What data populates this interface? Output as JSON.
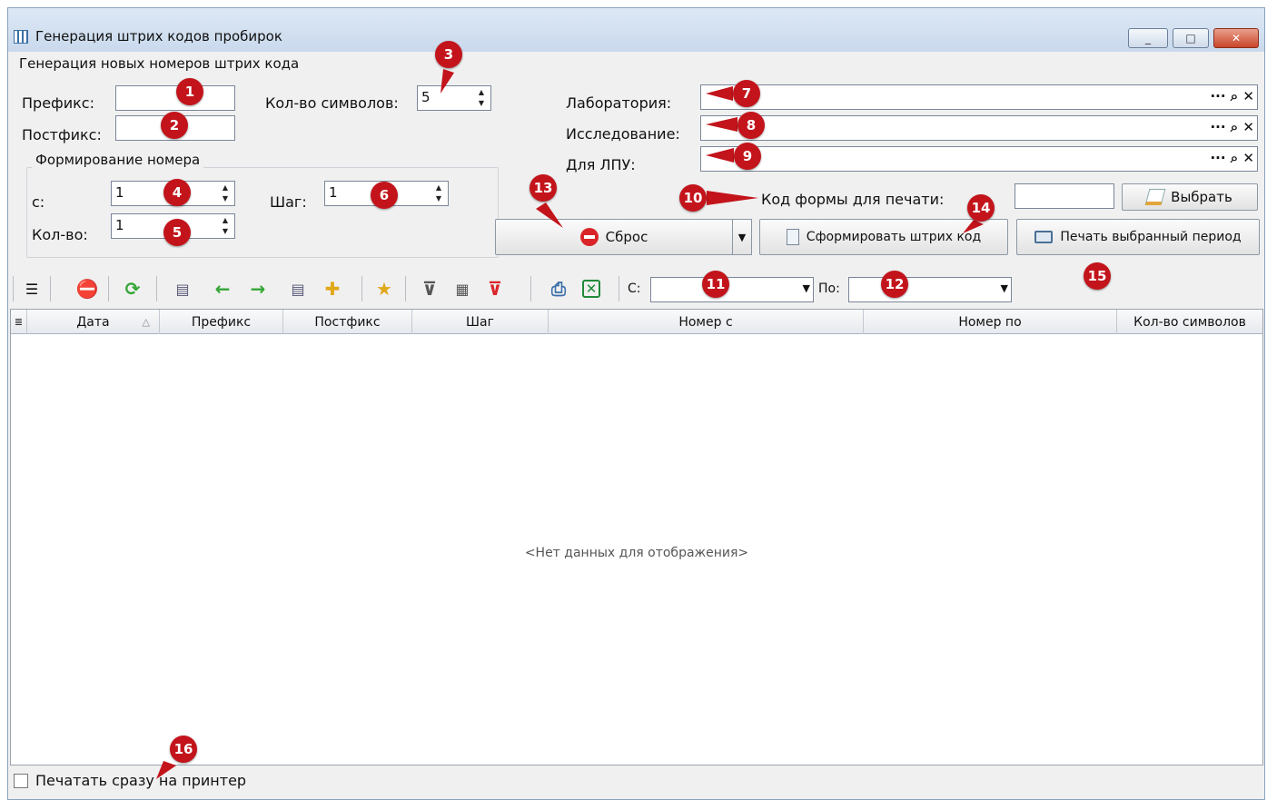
{
  "window": {
    "title": "Генерация штрих кодов пробирок",
    "controls": [
      "_",
      "□",
      "✕"
    ]
  },
  "generation": {
    "section_title": "Генерация новых номеров штрих кода",
    "prefix_label": "Префикс:",
    "prefix_value": "",
    "postfix_label": "Постфикс:",
    "postfix_value": "",
    "symbols_label": "Кол-во символов:",
    "symbols_value": "5",
    "numbering_title": "Формирование номера",
    "from_label": "с:",
    "from_value": "1",
    "count_label": "Кол-во:",
    "count_value": "1",
    "step_label": "Шаг:",
    "step_value": "1"
  },
  "lookups": {
    "laboratory_label": "Лаборатория:",
    "research_label": "Исследование:",
    "lpu_label": "Для ЛПУ:",
    "buttons": "··· ⌕ ✕",
    "print_form_label": "Код формы для печати:",
    "print_form_value": "",
    "choose_label": "Выбрать"
  },
  "actions": {
    "reset_label": "Сброс",
    "generate_label": "Сформировать штрих код",
    "print_period_label": "Печать выбранный период"
  },
  "toolbar": {
    "from_label": "С:",
    "to_label": "По:",
    "from_value": "",
    "to_value": ""
  },
  "grid": {
    "columns": [
      "Дата",
      "Префикс",
      "Постфикс",
      "Шаг",
      "Номер с",
      "Номер по",
      "Кол-во символов"
    ],
    "empty_text": "<Нет данных для отображения>"
  },
  "footer": {
    "print_direct_label": "Печатать сразу на принтер",
    "print_direct_checked": false
  },
  "badges": [
    "1",
    "2",
    "3",
    "4",
    "5",
    "6",
    "7",
    "8",
    "9",
    "10",
    "11",
    "12",
    "13",
    "14",
    "15",
    "16"
  ],
  "colors": {
    "badge": "#c3141b",
    "titlebar": "#c9d9ec",
    "window_bg": "#f0f0f0"
  }
}
